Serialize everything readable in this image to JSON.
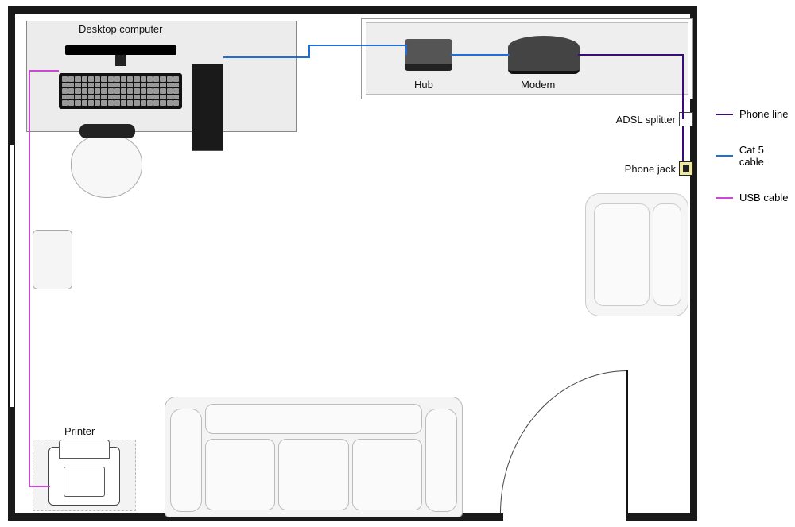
{
  "labels": {
    "desktop": "Desktop computer",
    "hub": "Hub",
    "modem": "Modem",
    "adsl": "ADSL splitter",
    "phonejack": "Phone jack",
    "printer": "Printer"
  },
  "legend": {
    "phone": "Phone line",
    "cat5": "Cat 5 cable",
    "usb": "USB cable"
  },
  "colors": {
    "phone": "#3b0a7a",
    "cat5": "#1f6fd8",
    "usb": "#c948d6"
  }
}
